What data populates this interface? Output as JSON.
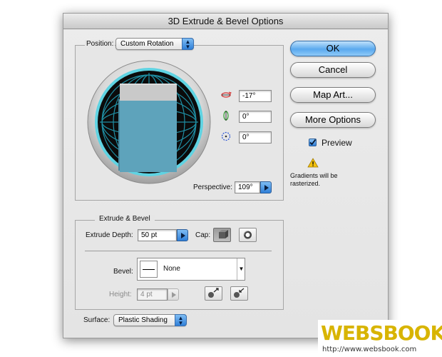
{
  "dialog": {
    "title": "3D Extrude & Bevel Options"
  },
  "position": {
    "label": "Position:",
    "value": "Custom Rotation",
    "rotation_x": "-17°",
    "rotation_y": "0°",
    "rotation_z": "0°",
    "perspective_label": "Perspective:",
    "perspective_value": "109°"
  },
  "extrude_bevel": {
    "section_title": "Extrude & Bevel",
    "depth_label": "Extrude Depth:",
    "depth_value": "50 pt",
    "cap_label": "Cap:",
    "bevel_label": "Bevel:",
    "bevel_value": "None",
    "height_label": "Height:",
    "height_value": "4 pt"
  },
  "surface": {
    "label": "Surface:",
    "value": "Plastic Shading"
  },
  "buttons": {
    "ok": "OK",
    "cancel": "Cancel",
    "map_art": "Map Art...",
    "more_options": "More Options"
  },
  "preview": {
    "label": "Preview",
    "checked": true
  },
  "warning": {
    "text_line1": "Gradients will be",
    "text_line2": "rasterized."
  },
  "watermark": {
    "brand": "WEBSBOOK",
    "url": "http://www.websbook.com"
  },
  "colors": {
    "accent_blue": "#3b8be0",
    "cube_face": "#5ea3bb",
    "cube_top": "#c9c9c9",
    "ring_cyan": "#7fdcea",
    "watermark_gold": "#d8b400"
  }
}
